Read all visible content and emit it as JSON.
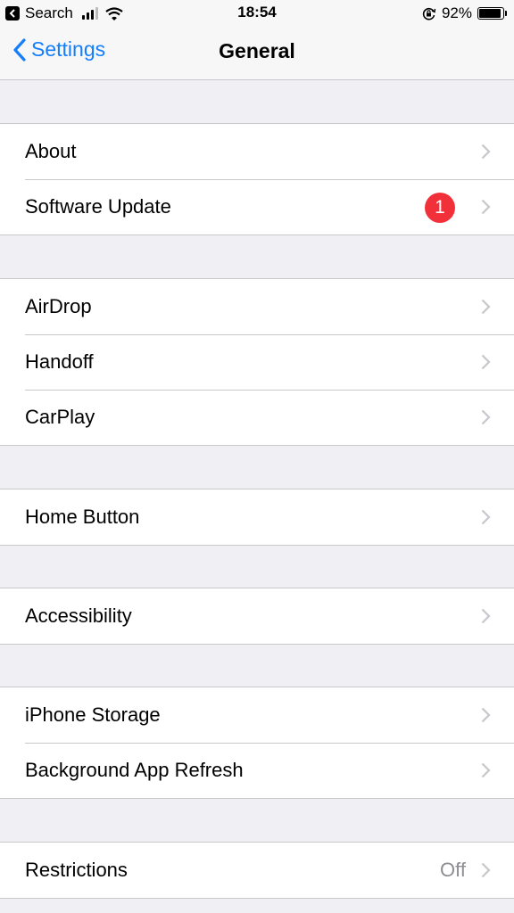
{
  "status_bar": {
    "back_app_label": "Search",
    "time": "18:54",
    "battery_percent": "92%",
    "battery_level": 0.92,
    "icons": [
      "back-to-app-icon",
      "signal-icon",
      "wifi-icon",
      "orientation-lock-icon",
      "battery-icon"
    ]
  },
  "nav": {
    "back_label": "Settings",
    "title": "General"
  },
  "accent_color": "#157efb",
  "badge_color": "#f2303a",
  "groups": [
    {
      "rows": [
        {
          "label": "About"
        },
        {
          "label": "Software Update",
          "badge": "1"
        }
      ]
    },
    {
      "rows": [
        {
          "label": "AirDrop"
        },
        {
          "label": "Handoff"
        },
        {
          "label": "CarPlay"
        }
      ]
    },
    {
      "rows": [
        {
          "label": "Home Button"
        }
      ]
    },
    {
      "rows": [
        {
          "label": "Accessibility"
        }
      ]
    },
    {
      "rows": [
        {
          "label": "iPhone Storage"
        },
        {
          "label": "Background App Refresh"
        }
      ]
    },
    {
      "rows": [
        {
          "label": "Restrictions",
          "value": "Off"
        }
      ]
    }
  ]
}
